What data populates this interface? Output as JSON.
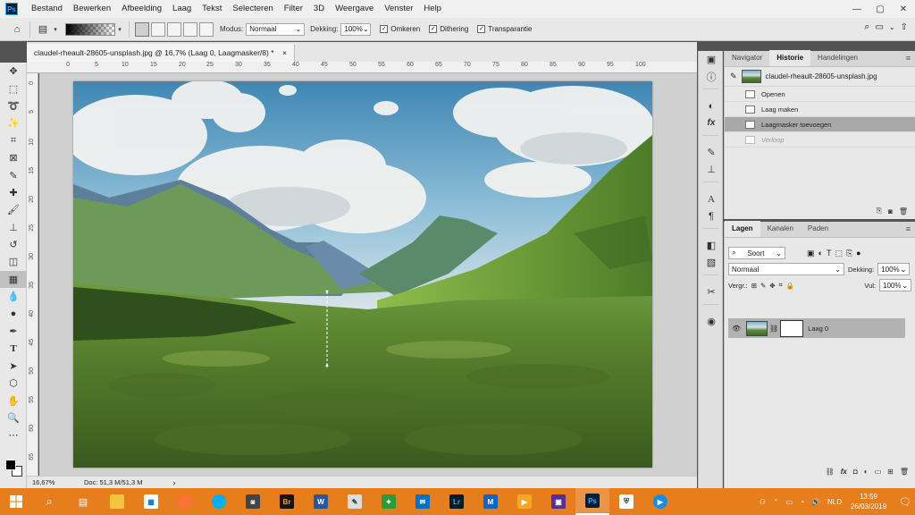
{
  "app": {
    "logo": "Ps"
  },
  "menu": [
    "Bestand",
    "Bewerken",
    "Afbeelding",
    "Laag",
    "Tekst",
    "Selecteren",
    "Filter",
    "3D",
    "Weergave",
    "Venster",
    "Help"
  ],
  "window_controls": {
    "minimize": "—",
    "restore": "▢",
    "close": "✕"
  },
  "options": {
    "mode_label": "Modus:",
    "mode_value": "Normaal",
    "opacity_label": "Dekking:",
    "opacity_value": "100%",
    "reverse_label": "Omkeren",
    "dither_label": "Dithering",
    "transparency_label": "Transparantie",
    "checkbox_mark": "✓"
  },
  "document": {
    "tab_title": "claudel-rheault-28605-unsplash.jpg @ 16,7% (Laag 0, Laagmasker/8) *",
    "tab_close": "×",
    "ruler_h": [
      "0",
      "5",
      "10",
      "15",
      "20",
      "25",
      "30",
      "35",
      "40",
      "45",
      "50",
      "55",
      "60",
      "65",
      "70",
      "75",
      "80",
      "85",
      "90",
      "95",
      "100"
    ],
    "ruler_v": [
      "0",
      "5",
      "10",
      "15",
      "20",
      "25",
      "30",
      "35",
      "40",
      "45",
      "50",
      "55",
      "60",
      "65"
    ]
  },
  "status": {
    "zoom": "16,67%",
    "doc_info": "Doc: 51,3 M/51,3 M",
    "arrow": "›"
  },
  "history_panel": {
    "tabs": [
      "Navigator",
      "Historie",
      "Handelingen"
    ],
    "menu_icon": "≡",
    "snapshot_label": "claudel-rheault-28605-unsplash.jpg",
    "items": [
      {
        "label": "Openen",
        "state": "normal"
      },
      {
        "label": "Laag maken",
        "state": "normal"
      },
      {
        "label": "Laagmasker toevoegen",
        "state": "selected"
      },
      {
        "label": "Verloop",
        "state": "future"
      }
    ]
  },
  "layers_panel": {
    "tabs": [
      "Lagen",
      "Kanalen",
      "Paden"
    ],
    "menu_icon": "≡",
    "filter_label": "Soort",
    "blend_mode": "Normaal",
    "opacity_label": "Dekking:",
    "opacity_value": "100%",
    "lock_label": "Vergr.:",
    "fill_label": "Vul:",
    "fill_value": "100%",
    "layer_name": "Laag 0",
    "footer_icons": [
      "link-icon",
      "fx-icon",
      "mask-icon",
      "adjustment-icon",
      "folder-icon",
      "new-layer-icon",
      "trash-icon"
    ]
  },
  "taskbar": {
    "ps_label": "Ps",
    "br_label": "Br",
    "word_label": "W",
    "lr_label": "Lr",
    "language": "NLD",
    "time": "13:59",
    "date": "26/03/2019"
  },
  "colors": {
    "taskbar": "#e67e1e",
    "ui_panel": "#e8e8e8",
    "selected_row": "#a8a8a8"
  }
}
